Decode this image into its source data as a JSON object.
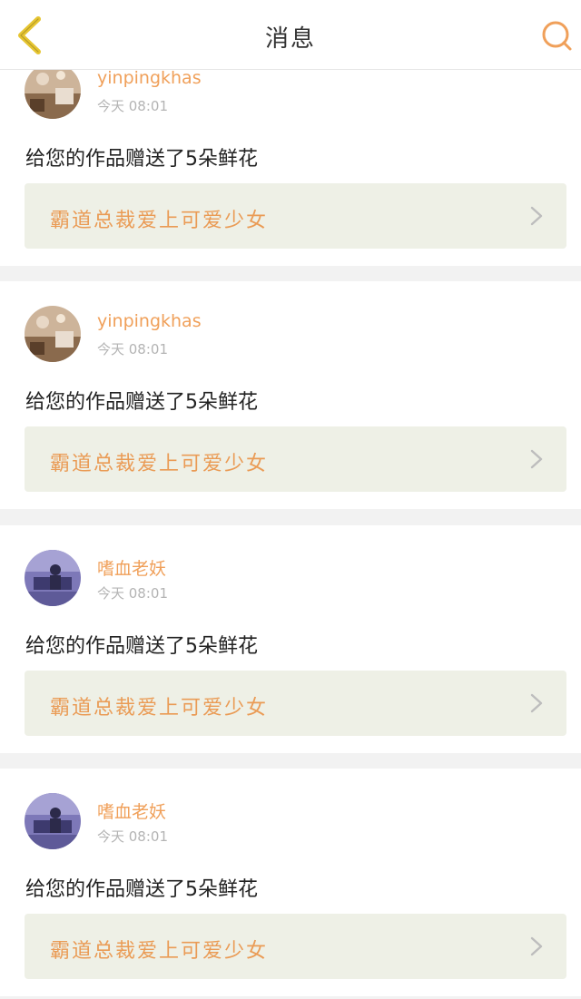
{
  "header": {
    "title": "消息",
    "back_icon": "chevron-left-icon",
    "search_icon": "search-icon"
  },
  "colors": {
    "accent": "#f0a05a",
    "back_arrow": "#e6c531",
    "work_bg": "#eef0e6"
  },
  "notifications": [
    {
      "username": "yinpingkhas",
      "time": "今天 08:01",
      "message": "给您的作品赠送了5朵鲜花",
      "work_title": "霸道总裁爱上可爱少女",
      "avatar": "room-avatar"
    },
    {
      "username": "yinpingkhas",
      "time": "今天 08:01",
      "message": "给您的作品赠送了5朵鲜花",
      "work_title": "霸道总裁爱上可爱少女",
      "avatar": "room-avatar"
    },
    {
      "username": "嗜血老妖",
      "time": "今天 08:01",
      "message": "给您的作品赠送了5朵鲜花",
      "work_title": "霸道总裁爱上可爱少女",
      "avatar": "desk-avatar"
    },
    {
      "username": "嗜血老妖",
      "time": "今天 08:01",
      "message": "给您的作品赠送了5朵鲜花",
      "work_title": "霸道总裁爱上可爱少女",
      "avatar": "desk-avatar"
    }
  ]
}
